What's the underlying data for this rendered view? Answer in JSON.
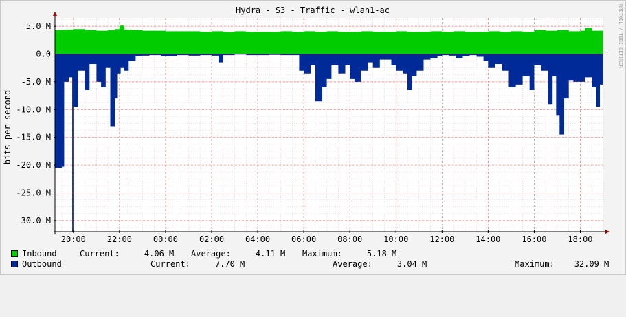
{
  "chart_data": {
    "type": "area",
    "title": "Hydra - S3 - Traffic - wlan1-ac",
    "ylabel": "bits per second",
    "watermark": "RRDTOOL / TOBI OETIKER",
    "ylim": [
      -32000000,
      6500000
    ],
    "y_ticks": [
      {
        "value": 5000000,
        "label": "5.0 M"
      },
      {
        "value": 0,
        "label": "0.0"
      },
      {
        "value": -5000000,
        "label": "-5.0 M"
      },
      {
        "value": -10000000,
        "label": "-10.0 M"
      },
      {
        "value": -15000000,
        "label": "-15.0 M"
      },
      {
        "value": -20000000,
        "label": "-20.0 M"
      },
      {
        "value": -25000000,
        "label": "-25.0 M"
      },
      {
        "value": -30000000,
        "label": "-30.0 M"
      }
    ],
    "x_range_hours": [
      19.2,
      43.0
    ],
    "x_ticks": [
      {
        "hour": 20,
        "label": "20:00"
      },
      {
        "hour": 22,
        "label": "22:00"
      },
      {
        "hour": 24,
        "label": "00:00"
      },
      {
        "hour": 26,
        "label": "02:00"
      },
      {
        "hour": 28,
        "label": "04:00"
      },
      {
        "hour": 30,
        "label": "06:00"
      },
      {
        "hour": 32,
        "label": "08:00"
      },
      {
        "hour": 34,
        "label": "10:00"
      },
      {
        "hour": 36,
        "label": "12:00"
      },
      {
        "hour": 38,
        "label": "14:00"
      },
      {
        "hour": 40,
        "label": "16:00"
      },
      {
        "hour": 42,
        "label": "18:00"
      }
    ],
    "series": [
      {
        "name": "Inbound",
        "color": "#00cc00",
        "x": [
          19.2,
          19.6,
          20.0,
          20.5,
          21.0,
          21.5,
          21.8,
          22.0,
          22.2,
          22.5,
          23.0,
          23.5,
          24.0,
          24.5,
          25.0,
          25.5,
          26.0,
          26.5,
          27.0,
          27.5,
          28.0,
          28.5,
          29.0,
          29.5,
          30.0,
          30.5,
          31.0,
          31.5,
          32.0,
          32.5,
          33.0,
          33.5,
          34.0,
          34.5,
          35.0,
          35.5,
          36.0,
          36.5,
          37.0,
          37.5,
          38.0,
          38.5,
          39.0,
          39.5,
          40.0,
          40.5,
          41.0,
          41.5,
          42.0,
          42.2,
          42.5,
          43.0
        ],
        "values": [
          4300000,
          4400000,
          4500000,
          4300000,
          4200000,
          4300000,
          4500000,
          5100000,
          4400000,
          4300000,
          4200000,
          4200000,
          4100000,
          4100000,
          4100000,
          4000000,
          4100000,
          4000000,
          4100000,
          4000000,
          4000000,
          4000000,
          4100000,
          4000000,
          4100000,
          4000000,
          4100000,
          4000000,
          4000000,
          4100000,
          4000000,
          4000000,
          4100000,
          4000000,
          4000000,
          4100000,
          4000000,
          4100000,
          4000000,
          4000000,
          4100000,
          4000000,
          4100000,
          4000000,
          4300000,
          4200000,
          4300000,
          4100000,
          4200000,
          4700000,
          4200000,
          4100000
        ]
      },
      {
        "name": "Outbound",
        "color": "#002a97",
        "x": [
          19.2,
          19.5,
          19.6,
          19.8,
          19.95,
          20.0,
          20.2,
          20.5,
          20.7,
          21.0,
          21.2,
          21.4,
          21.6,
          21.8,
          21.9,
          22.05,
          22.2,
          22.4,
          22.7,
          23.0,
          23.3,
          23.5,
          23.8,
          24.5,
          25.0,
          25.5,
          26.0,
          26.3,
          26.5,
          27.0,
          27.5,
          28.0,
          28.5,
          29.0,
          29.5,
          29.8,
          30.0,
          30.3,
          30.5,
          30.8,
          31.0,
          31.2,
          31.5,
          31.8,
          32.0,
          32.2,
          32.5,
          32.8,
          33.0,
          33.3,
          33.5,
          33.8,
          34.0,
          34.3,
          34.5,
          34.7,
          34.9,
          35.2,
          35.5,
          35.8,
          36.0,
          36.3,
          36.6,
          36.9,
          37.2,
          37.5,
          37.8,
          38.0,
          38.3,
          38.6,
          38.9,
          39.2,
          39.5,
          39.8,
          40.0,
          40.3,
          40.6,
          40.8,
          40.95,
          41.1,
          41.3,
          41.5,
          41.7,
          41.9,
          42.2,
          42.5,
          42.7,
          42.85,
          43.0
        ],
        "values": [
          -20500000,
          -20300000,
          -5000000,
          -4200000,
          -32000000,
          -9500000,
          -3000000,
          -6500000,
          -1800000,
          -5000000,
          -6000000,
          -2500000,
          -13000000,
          -8000000,
          -3500000,
          -2500000,
          -3000000,
          -1200000,
          -400000,
          -300000,
          -200000,
          -200000,
          -400000,
          -200000,
          -300000,
          -200000,
          -300000,
          -1500000,
          -200000,
          -100000,
          -200000,
          -200000,
          -150000,
          -200000,
          -200000,
          -3000000,
          -3500000,
          -2000000,
          -8500000,
          -6000000,
          -4500000,
          -2000000,
          -3500000,
          -2000000,
          -4500000,
          -5000000,
          -3000000,
          -1500000,
          -2500000,
          -1000000,
          -1000000,
          -2000000,
          -3000000,
          -3500000,
          -6500000,
          -4000000,
          -3000000,
          -1000000,
          -800000,
          -400000,
          -200000,
          -300000,
          -800000,
          -400000,
          -200000,
          -500000,
          -1200000,
          -2500000,
          -1800000,
          -3000000,
          -6000000,
          -5500000,
          -4000000,
          -6500000,
          -2000000,
          -3000000,
          -9000000,
          -4000000,
          -11000000,
          -14500000,
          -8000000,
          -4800000,
          -5000000,
          -5000000,
          -4200000,
          -6000000,
          -9500000,
          -5500000,
          -7500000
        ]
      }
    ],
    "legend": {
      "inbound": {
        "label": "Inbound",
        "current": "Current:     4.06 M",
        "average": "Average:     4.11 M",
        "maximum": "Maximum:     5.18 M"
      },
      "outbound": {
        "label": "Outbound",
        "current": "Current:     7.70 M",
        "average": "Average:     3.04 M",
        "maximum": "Maximum:    32.09 M"
      }
    }
  }
}
